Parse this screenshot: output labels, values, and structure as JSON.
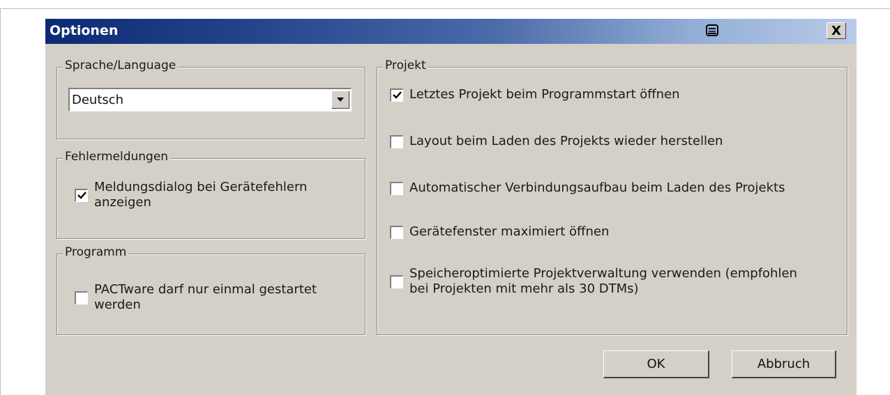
{
  "dialog": {
    "title": "Optionen",
    "help_icon": "help-icon",
    "close_label": "X"
  },
  "language_group": {
    "legend": "Sprache/Language",
    "selected": "Deutsch"
  },
  "errors_group": {
    "legend": "Fehlermeldungen",
    "show_dialog": {
      "label_line1": "Meldungsdialog bei Gerätefehlern",
      "label_line2": "anzeigen",
      "checked": true
    }
  },
  "program_group": {
    "legend": "Programm",
    "single_instance": {
      "label_line1": "PACTware darf nur einmal gestartet",
      "label_line2": "werden",
      "checked": false
    }
  },
  "project_group": {
    "legend": "Projekt",
    "options": [
      {
        "label_line1": "Letztes Projekt beim Programmstart öffnen",
        "label_line2": "",
        "checked": true
      },
      {
        "label_line1": "Layout beim Laden des Projekts wieder herstellen",
        "label_line2": "",
        "checked": false
      },
      {
        "label_line1": "Automatischer Verbindungsaufbau beim Laden des Projekts",
        "label_line2": "",
        "checked": false
      },
      {
        "label_line1": "Gerätefenster maximiert öffnen",
        "label_line2": "",
        "checked": false
      },
      {
        "label_line1": "Speicheroptimierte Projektverwaltung verwenden (empfohlen",
        "label_line2": "bei Projekten mit mehr als 30 DTMs)",
        "checked": false
      }
    ]
  },
  "buttons": {
    "ok": "OK",
    "cancel": "Abbruch"
  }
}
